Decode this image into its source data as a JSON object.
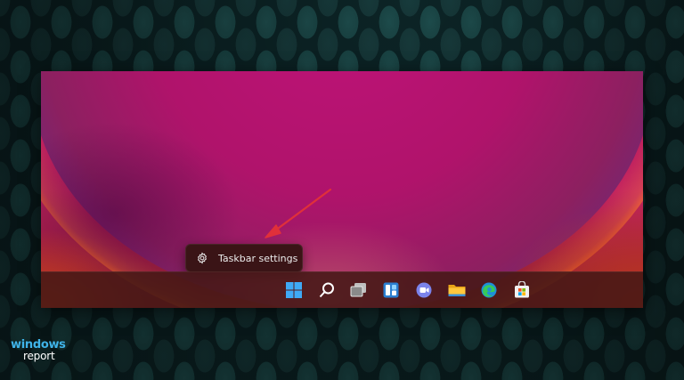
{
  "context_menu": {
    "item_label": "Taskbar settings",
    "item_icon": "gear-icon"
  },
  "taskbar": {
    "icons": [
      {
        "name": "start-icon",
        "color": "#3fa9f5"
      },
      {
        "name": "search-icon",
        "color": "#ffffff"
      },
      {
        "name": "task-view-icon",
        "color": "#d9d9d9"
      },
      {
        "name": "widgets-icon",
        "color": "#4cc2ff"
      },
      {
        "name": "teams-chat-icon",
        "color": "#7b83eb"
      },
      {
        "name": "file-explorer-icon",
        "color": "#ffc83d"
      },
      {
        "name": "edge-icon",
        "color": "#1ebbee"
      },
      {
        "name": "microsoft-store-icon",
        "color": "#f25022"
      }
    ]
  },
  "brand": {
    "line1": "windows",
    "line2": "report"
  },
  "colors": {
    "annotation_arrow": "#e0303a",
    "taskbar_bg": "#461816",
    "menu_bg": "#3a1416"
  }
}
